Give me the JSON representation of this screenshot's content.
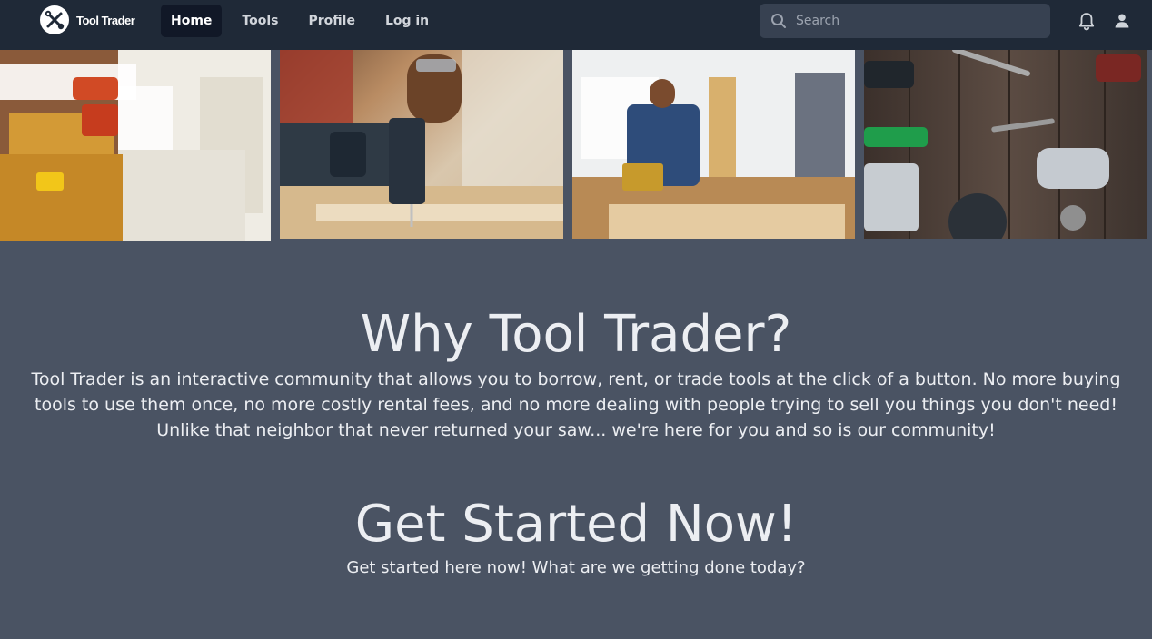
{
  "brand": {
    "name": "Tool Trader",
    "logo_icon": "wrench-screwdriver-icon"
  },
  "nav": {
    "items": [
      {
        "label": "Home",
        "active": true
      },
      {
        "label": "Tools",
        "active": false
      },
      {
        "label": "Profile",
        "active": false
      },
      {
        "label": "Log in",
        "active": false
      }
    ]
  },
  "search": {
    "placeholder": "Search",
    "value": ""
  },
  "header_icons": [
    "bell-icon",
    "user-icon"
  ],
  "gallery": [
    {
      "subject": "worker with drill and tool belt"
    },
    {
      "subject": "carpenter drilling wood"
    },
    {
      "subject": "carpenter measuring board"
    },
    {
      "subject": "tools on wooden table"
    }
  ],
  "why": {
    "title": "Why Tool Trader?",
    "body": "Tool Trader is an interactive community that allows you to borrow, rent, or trade tools at the click of a button. No more buying tools to use them once, no more costly rental fees, and no more dealing with people trying to sell you things you don't need! Unlike that neighbor that never returned your saw... we're here for you and so is our community!"
  },
  "get_started": {
    "title": "Get Started Now!",
    "body": "Get started here now! What are we getting done today?"
  },
  "colors": {
    "navbar": "#1f2937",
    "page_background": "#4a5363",
    "active_tab": "#111827",
    "search_background": "#374151"
  }
}
